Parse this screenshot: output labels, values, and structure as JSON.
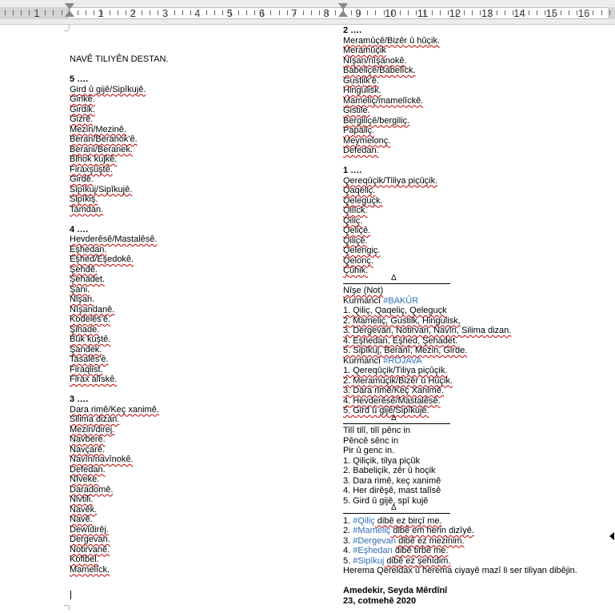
{
  "ruler": {
    "left_numbers": [
      "1",
      "1",
      "2",
      "3",
      "4",
      "5",
      "6",
      "7",
      "8"
    ],
    "right_numbers": [
      "9",
      "10",
      "11",
      "12",
      "13",
      "14",
      "15",
      "16"
    ]
  },
  "col1": {
    "title": "NAVÊ TILIYÊN DESTAN.",
    "sec5": {
      "head": "5 ….",
      "items": [
        "Gird û gijê/Sipîkujê.",
        "Girikê.",
        "Girdik.",
        "Gizrê.",
        "Mezin/Mezinê.",
        "Beran/Beranok'ê.",
        "Berani/Beranek.",
        "Bihok kujkê.",
        "Firaxşûştê.",
        "Girdê.",
        "Sipîkuj/Sipîkujê.",
        "Sipîkiş.",
        "Tamdan."
      ]
    },
    "sec4": {
      "head": "4 ….",
      "items": [
        "Hevderêsê/Mastalêsê.",
        "Eşhedan.",
        "Eşhed/Eşedokê.",
        "Şehdê.",
        "Şehadet.",
        "Şani.",
        "Nişan.",
        "Nîşandanê.",
        "Kodelês'ê.",
        "Şihade.",
        "Bûk kuştê.",
        "Şandek.",
        "Tasalês'ê.",
        "Firaqlist.",
        "Firax alîskê."
      ]
    },
    "sec3": {
      "head": "3 ….",
      "items": [
        "Dara rimê/Keç xanimê.",
        "Silima dizan.",
        "Mezin/direj.",
        "Navberê.",
        "Navçarê.",
        "Navîn/navînokê.",
        "Defedan.",
        "Nîveke.",
        "Daradomê.",
        "Nivtili.",
        "Navêk.",
        "Navê.",
        "Dewîdirêj.",
        "Dergevan.",
        "Notirvanê.",
        "Kofibel.",
        "Mamelîck."
      ]
    }
  },
  "col2": {
    "sec2": {
      "head": "2 ….",
      "items": [
        "Meramûçê/Bizêr û hûçik.",
        "Meramûçik",
        "Nîşan/nîşanokê.",
        "Babeliçê/Babelîck.",
        "Gustilk'ê.",
        "Hingulisk.",
        "Mameliç/mamelîckê.",
        "Gistile.",
        "Bergiliçê/bergiliç.",
        "Papaliç.",
        "Meymelonç.",
        "Defedan."
      ]
    },
    "sec1": {
      "head": "1 ….",
      "items": [
        "Qereqûçik/Tiliya piçûçik.",
        "Qaqeliç.",
        "Qeleguçk.",
        "Qilîck.",
        "Qiliç.",
        "Qeliçê.",
        "Qiliçê.",
        "Qelengiç.",
        "Qelonç.",
        "Çûhik."
      ]
    },
    "divider_mark": "Δ",
    "not_label": "Nîşe (Not)",
    "kurmanci_bakur": {
      "prefix": "Kurmancî ",
      "tag": "#BAKÛR"
    },
    "bakur_list": [
      "1. Qiliç, Qaqeliç, Qeleguçk",
      "2. Mameliç, Gustilk, Hingulisk,",
      "3. Dergevan, Notirvan, Navîn, Silima dizan.",
      "4. Eşhedan, Eşhed, Şehadet.",
      "5. Sipîkuj, Beranî, Mezin, Girde."
    ],
    "kurmanci_rojava": {
      "prefix": "Kurmancî ",
      "tag": "#ROJAVA"
    },
    "rojava_list": [
      "1. Qereqûçik/Tiliya piçûçik.",
      "2. Meramûçik/Bizêr û Hûçik.",
      "3. Dara rimê/Keç Xanimê.",
      "4. Hevderêsê/Mastalêsê.",
      "5. Gird û gijê/Sipîkujê."
    ],
    "rhyme": [
      "Tilî tilî, tilî pênc in",
      "Pêncê sênc in",
      "Pir û genc in.",
      "1. Qiliçik, tilya piçûk",
      "2. Babeliçik, zêr û hoçik",
      "3. Dara rimê, keç xanimê",
      "4. Her dirêşê, mast talîsê",
      "5. Gird û gijê, spî kujê"
    ],
    "final": [
      {
        "num": "1. ",
        "tag": "#Qiliç",
        "rest": " dibê ez birçî me."
      },
      {
        "num": "2. ",
        "tag": "#Mameliç",
        "rest": " dibê em herin dizîyê."
      },
      {
        "num": "3. ",
        "tag": "#Dergevan",
        "rest": " dibê ez mezinim."
      },
      {
        "num": "4. ",
        "tag": "#Eşhedan",
        "rest": " dibê tirbê me."
      },
      {
        "num": "5. ",
        "tag": "#Sipîkuj",
        "rest": " dibê ez şehîdim."
      }
    ],
    "closing": "Herema Qereidax û herema ciyayê mazî li ser tiliyan dibêjin.",
    "author": "Amedekir, Seyda Mêrdînî",
    "date": "23, cotmehê 2020"
  }
}
